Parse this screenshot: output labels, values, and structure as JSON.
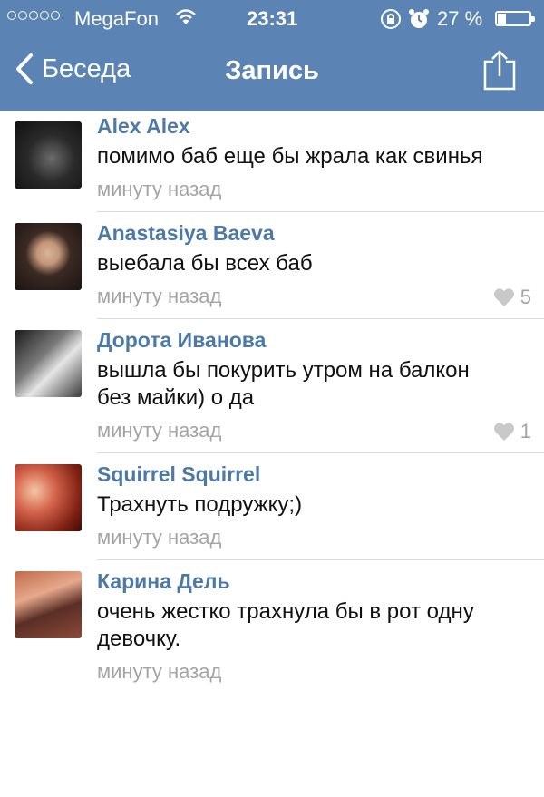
{
  "status_bar": {
    "carrier": "MegaFon",
    "time": "23:31",
    "battery": "27 %",
    "battery_level": 0.27
  },
  "nav": {
    "back_label": "Беседа",
    "title": "Запись"
  },
  "comments": [
    {
      "author": "Alex Alex",
      "lines": [
        "помимо баб еще бы жрала как свинья"
      ],
      "time": "минуту назад",
      "likes": ""
    },
    {
      "author": "Anastasiya Baeva",
      "lines": [
        "выебала бы всех баб"
      ],
      "time": "минуту назад",
      "likes": "5"
    },
    {
      "author": "Дорота Иванова",
      "lines": [
        "вышла бы покурить утром на балкон",
        "без майки) о да"
      ],
      "time": "минуту назад",
      "likes": "1"
    },
    {
      "author": "Squirrel Squirrel",
      "lines": [
        "Трахнуть подружку;)"
      ],
      "time": "минуту назад",
      "likes": ""
    },
    {
      "author": "Карина Дель",
      "lines": [
        "очень жестко трахнула бы в рот одну",
        "девочку."
      ],
      "time": "минуту назад",
      "likes": ""
    }
  ]
}
